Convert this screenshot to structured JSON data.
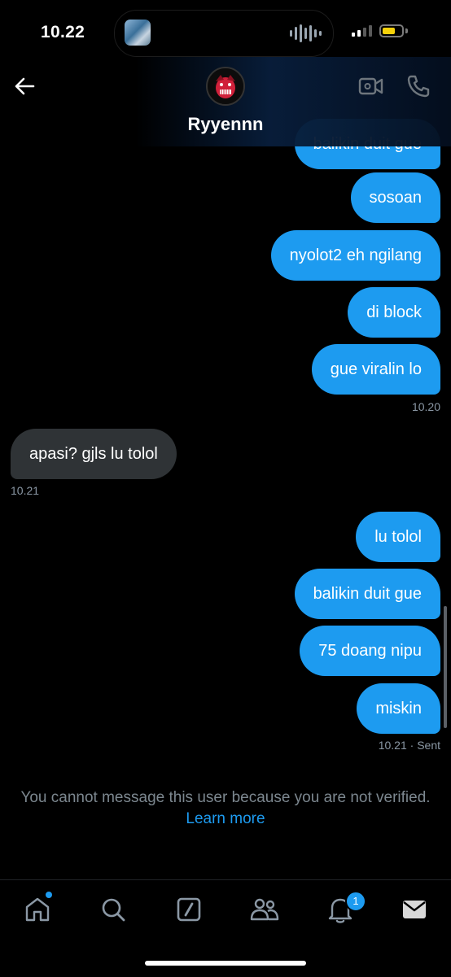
{
  "status_bar": {
    "time": "10.22"
  },
  "header": {
    "contact_name": "Ryyennn"
  },
  "messages": [
    {
      "text": "balikin duit gue"
    },
    {
      "text": "sosoan"
    },
    {
      "text": "nyolot2 eh ngilang"
    },
    {
      "text": "di block"
    },
    {
      "text": "gue viralin lo"
    },
    {
      "text": "apasi? gjls lu tolol"
    },
    {
      "text": "lu tolol"
    },
    {
      "text": "balikin duit gue"
    },
    {
      "text": "75 doang nipu"
    },
    {
      "text": "miskin"
    }
  ],
  "timestamps": {
    "t1": "10.20",
    "t2": "10.21",
    "t3": "10.21",
    "t3_status": "· Sent"
  },
  "notice": {
    "text": "You cannot message this user because you are not verified.",
    "link": "Learn more"
  },
  "nav": {
    "notifications_count": "1",
    "items": [
      "home-icon",
      "search-icon",
      "compose-icon",
      "communities-icon",
      "bell-icon",
      "mail-icon"
    ]
  },
  "colors": {
    "accent": "#1d9bf0",
    "received_bubble": "#2f3336",
    "background": "#000000"
  }
}
